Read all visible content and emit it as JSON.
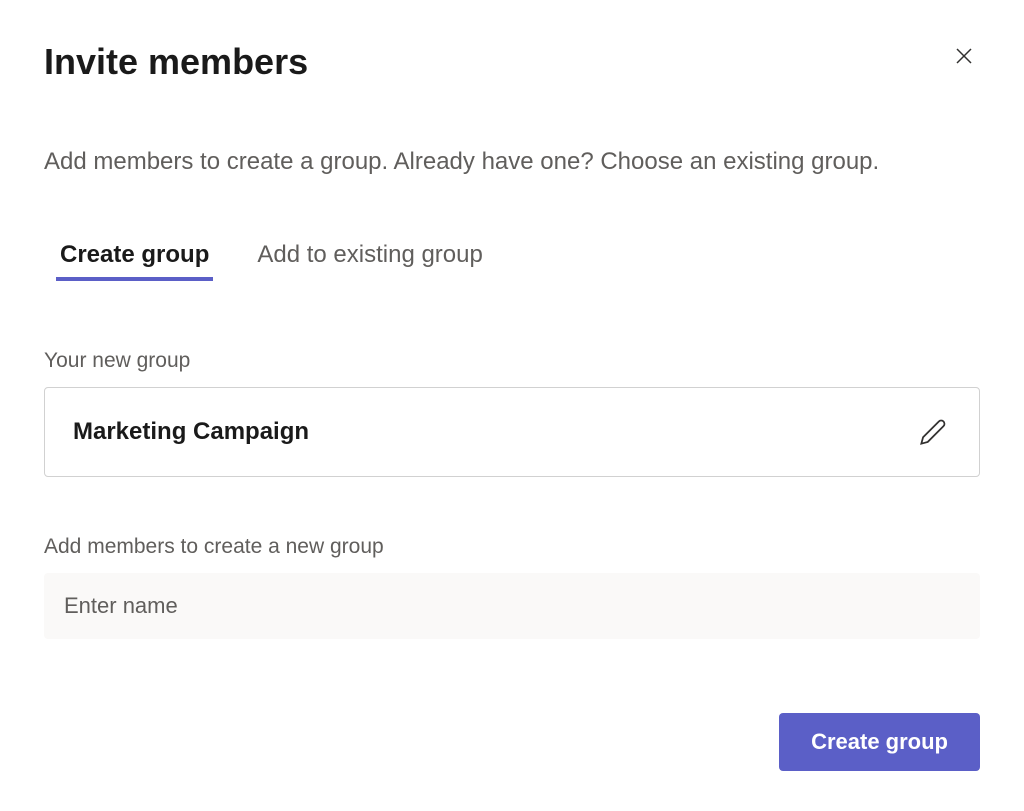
{
  "dialog": {
    "title": "Invite members",
    "description": "Add members to create a group. Already have one? Choose an existing group."
  },
  "tabs": {
    "create": "Create group",
    "existing": "Add to existing group"
  },
  "form": {
    "group_label": "Your new group",
    "group_name": "Marketing Campaign",
    "add_members_label": "Add members to create a new group",
    "name_placeholder": "Enter name"
  },
  "actions": {
    "create_button": "Create group"
  }
}
